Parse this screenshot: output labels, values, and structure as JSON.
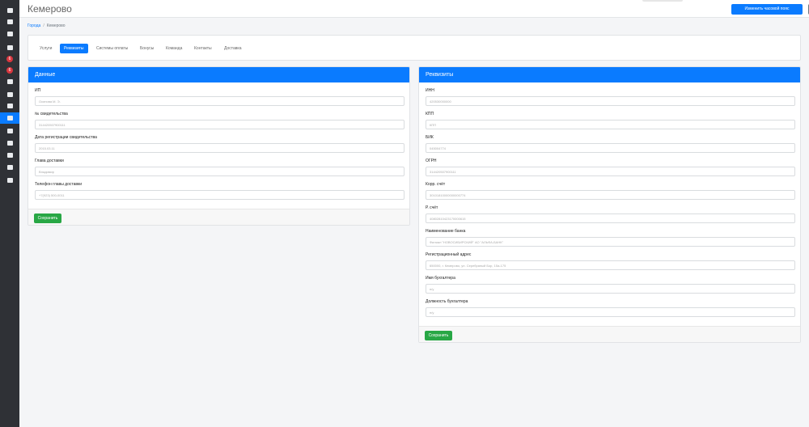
{
  "sidebar": {
    "items": [
      {
        "icon": "menu-icon",
        "badge": ""
      },
      {
        "icon": "mail-icon",
        "badge": ""
      },
      {
        "icon": "cart-icon",
        "badge": ""
      },
      {
        "icon": "image-icon",
        "badge": ""
      },
      {
        "icon": "notification-icon",
        "badge": "6"
      },
      {
        "icon": "notification-icon",
        "badge": "6"
      },
      {
        "icon": "thumbs-up-icon",
        "badge": ""
      },
      {
        "icon": "user-icon",
        "badge": ""
      },
      {
        "icon": "user-icon",
        "badge": ""
      },
      {
        "icon": "home-icon",
        "badge": ""
      },
      {
        "icon": "help-icon",
        "badge": ""
      },
      {
        "icon": "list-icon",
        "badge": ""
      },
      {
        "icon": "filter-icon",
        "badge": ""
      },
      {
        "icon": "wrench-icon",
        "badge": ""
      },
      {
        "icon": "document-icon",
        "badge": ""
      }
    ],
    "active_index": 9
  },
  "header": {
    "title": "Кемерово",
    "timezone_button": "Изменить часовой пояс",
    "settings_button": "+ ⚙"
  },
  "breadcrumb": {
    "link": "Города",
    "separator": "/",
    "current": "Кемерово"
  },
  "tabs": [
    {
      "label": "Услуги",
      "active": false
    },
    {
      "label": "Реквизиты",
      "active": true
    },
    {
      "label": "Системы оплаты",
      "active": false
    },
    {
      "label": "Бонусы",
      "active": false
    },
    {
      "label": "Команда",
      "active": false
    },
    {
      "label": "Контакты",
      "active": false
    },
    {
      "label": "Доставка",
      "active": false
    }
  ],
  "left_panel": {
    "title": "Данные",
    "fields": [
      {
        "label": "ИП",
        "value": "Осипова М. Э."
      },
      {
        "label": "№ свидетельства",
        "value": "314420507900111"
      },
      {
        "label": "Дата регистрации свидетельства",
        "value": "2015.03.11"
      },
      {
        "label": "Глава доставки",
        "value": "Владимир"
      },
      {
        "label": "Телефон главы доставки",
        "value": "+7(923) 500-0011"
      }
    ],
    "save_label": "Сохранить"
  },
  "right_panel": {
    "title": "Реквизиты",
    "fields": [
      {
        "label": "ИНН",
        "value": "420530000000"
      },
      {
        "label": "КПП",
        "value": "КПП"
      },
      {
        "label": "БИК",
        "value": "045004774"
      },
      {
        "label": "ОГРН",
        "value": "314420507900111"
      },
      {
        "label": "Корр. счёт",
        "value": "30101810000000000774"
      },
      {
        "label": "Р. счёт",
        "value": "40802810423170000615"
      },
      {
        "label": "Наименование банка",
        "value": "Филиал \"НОВОСИБИРСКИЙ\" АО \"АЛЬФА-БАНК\""
      },
      {
        "label": "Регистрационный адрес",
        "value": "650000, г. Кемерово, ул. Серебряный Бор, 15а-175"
      },
      {
        "label": "Имя бухгалтера",
        "value": "н/у"
      },
      {
        "label": "Должность бухгалтера",
        "value": "н/у"
      }
    ],
    "save_label": "Сохранить"
  }
}
